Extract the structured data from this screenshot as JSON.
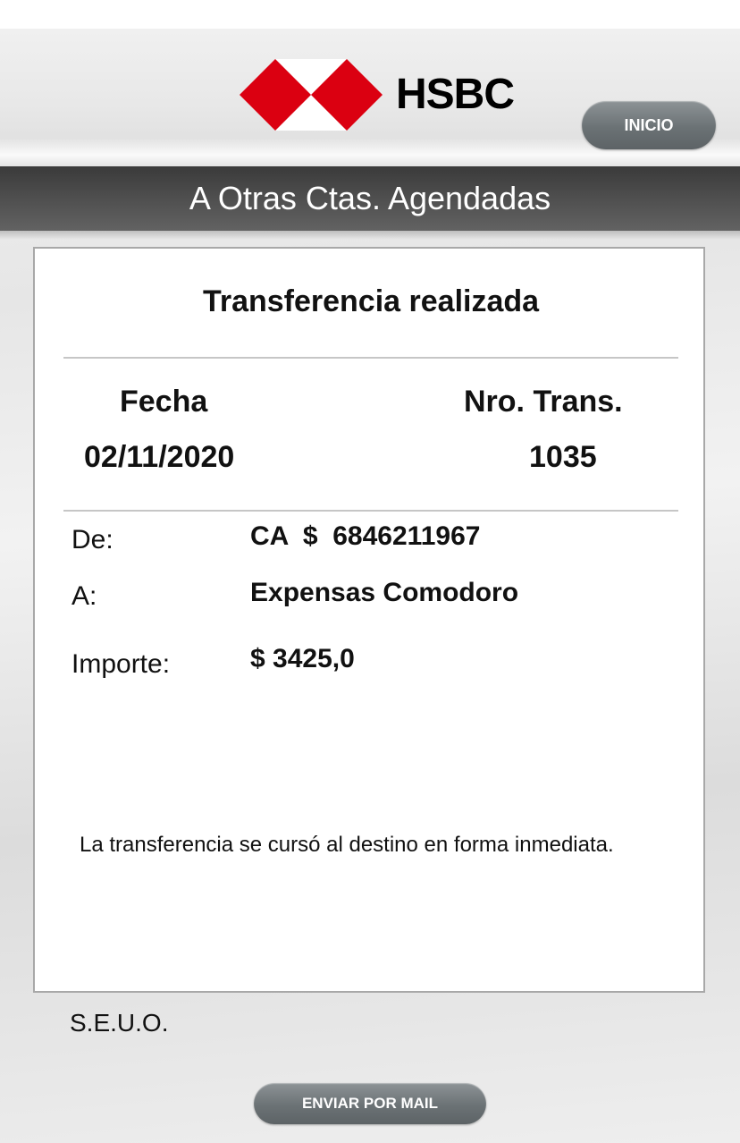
{
  "header": {
    "brand_name": "HSBC",
    "home_button_label": "INICIO",
    "brand_colors": {
      "red": "#db0011",
      "white": "#ffffff"
    }
  },
  "title_bar": {
    "title": "A Otras Ctas. Agendadas"
  },
  "receipt": {
    "heading": "Transferencia realizada",
    "date_label": "Fecha",
    "date_value": "02/11/2020",
    "transaction_label": "Nro. Trans.",
    "transaction_value": "1035",
    "from_label": "De:",
    "from_value": "CA  $  6846211967",
    "to_label": "A:",
    "to_value": "Expensas Comodoro",
    "amount_label": "Importe:",
    "amount_value": "$ 3425,0",
    "note": "La transferencia se cursó al destino en forma inmediata."
  },
  "footer": {
    "disclaimer": "S.E.U.O.",
    "send_mail_label": "ENVIAR POR MAIL"
  }
}
